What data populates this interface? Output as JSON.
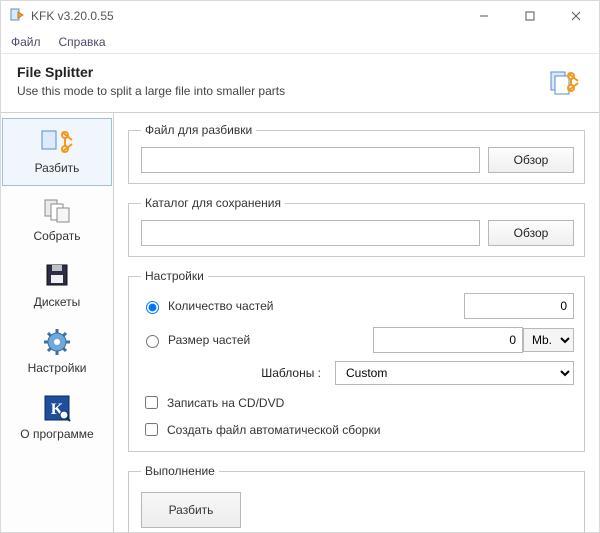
{
  "window": {
    "title": "KFK v3.20.0.55"
  },
  "menu": {
    "file": "Файл",
    "help": "Справка"
  },
  "header": {
    "title": "File Splitter",
    "subtitle": "Use this mode to split a large file into smaller parts"
  },
  "sidebar": {
    "items": [
      {
        "key": "split",
        "label": "Разбить"
      },
      {
        "key": "join",
        "label": "Собрать"
      },
      {
        "key": "floppy",
        "label": "Дискеты"
      },
      {
        "key": "settings",
        "label": "Настройки"
      },
      {
        "key": "about",
        "label": "О программе"
      }
    ]
  },
  "groups": {
    "file_to_split": {
      "legend": "Файл для разбивки",
      "value": "",
      "browse": "Обзор"
    },
    "save_dir": {
      "legend": "Каталог для сохранения",
      "value": "",
      "browse": "Обзор"
    },
    "settings": {
      "legend": "Настройки",
      "radio_count_label": "Количество частей",
      "count_value": "0",
      "radio_size_label": "Размер частей",
      "size_value": "0",
      "unit_selected": "Mb.",
      "templates_label": "Шаблоны :",
      "template_selected": "Custom",
      "cb_cd_label": "Записать на CD/DVD",
      "cb_autorebuild_label": "Создать файл автоматической сборки"
    },
    "execute": {
      "legend": "Выполнение",
      "split_btn": "Разбить"
    }
  }
}
